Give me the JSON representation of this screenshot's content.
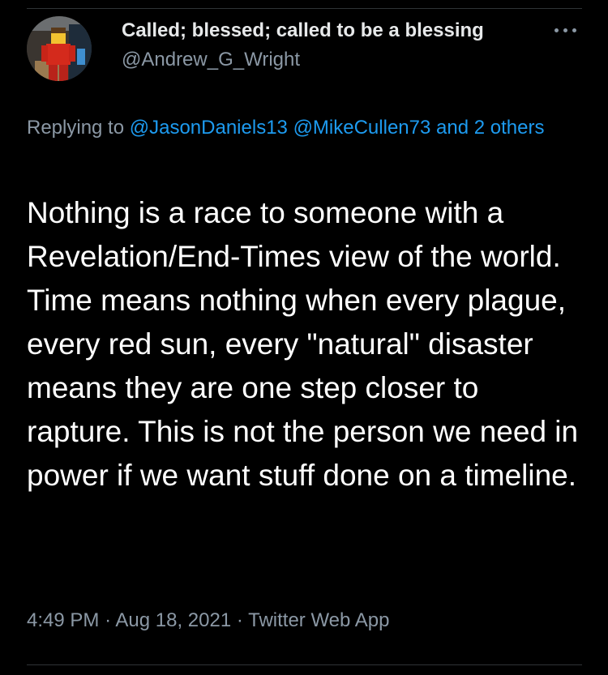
{
  "tweet": {
    "author": {
      "display_name": "Called; blessed; called to be a blessing",
      "handle": "@Andrew_G_Wright"
    },
    "more_icon": "more-horizontal-icon",
    "replying": {
      "prefix": "Replying to",
      "mention_1": "@JasonDaniels13",
      "mention_2": "@MikeCullen73",
      "others": "and 2 others"
    },
    "text": "Nothing is a race to someone with a Revelation/End-Times view of the world. Time means nothing when every plague, every red sun, every \"natural\" disaster means they are one step closer to rapture. This is not the person we need in power if we want stuff done on a timeline.",
    "time": "4:49 PM",
    "date": "Aug 18, 2021",
    "source": "Twitter Web App",
    "separator": "·"
  },
  "colors": {
    "background": "#000000",
    "text": "#ffffff",
    "secondary": "#8b98a5",
    "link": "#1d9bf0"
  }
}
